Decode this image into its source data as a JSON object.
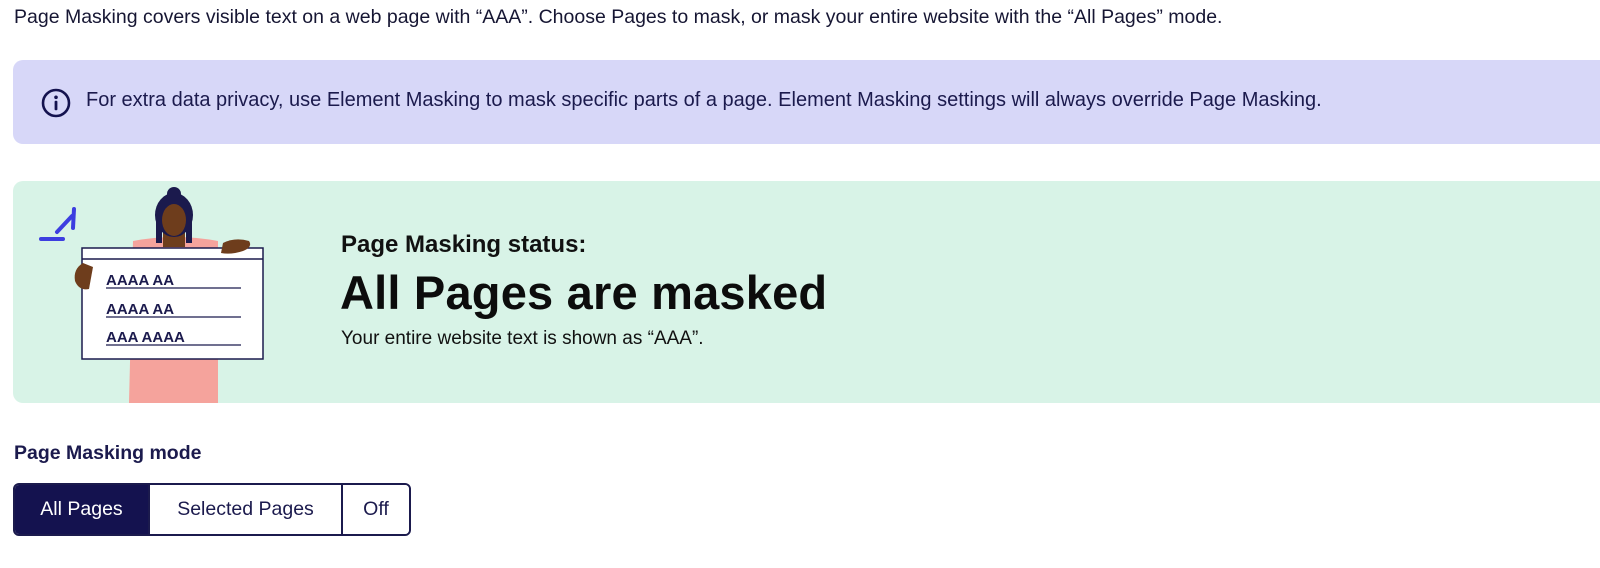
{
  "intro": {
    "text": "Page Masking covers visible text on a web page with “AAA”. Choose Pages to mask, or mask your entire website with the “All Pages” mode."
  },
  "info_banner": {
    "icon": "info-circle-icon",
    "text": "For extra data privacy, use Element Masking to mask specific parts of a page. Element Masking settings will always override Page Masking."
  },
  "status": {
    "label": "Page Masking status:",
    "headline": "All Pages are masked",
    "description": "Your entire website text is shown as “AAA”.",
    "illustration": {
      "sheet_lines": [
        "AAAA AA",
        "AAAA AA",
        "AAA AAAA"
      ]
    }
  },
  "mode": {
    "label": "Page Masking mode",
    "options": [
      {
        "label": "All Pages",
        "selected": true
      },
      {
        "label": "Selected Pages",
        "selected": false
      },
      {
        "label": "Off",
        "selected": false
      }
    ]
  },
  "colors": {
    "info_background": "#d7d7f8",
    "status_background": "#d8f3e7",
    "primary_navy": "#14124f",
    "text_navy": "#1b1a4d"
  }
}
